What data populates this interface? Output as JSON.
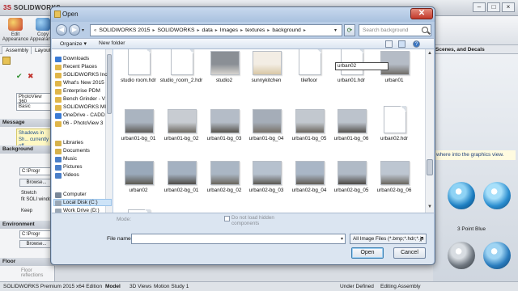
{
  "app": {
    "title_logo_brand": "SOLIDWORKS",
    "ribbon": [
      "Edit Appearance",
      "Copy Appearance"
    ],
    "tabs": [
      "Assembly",
      "Layout"
    ],
    "right_panel_title": "Scenes, and Decals",
    "hint_text": "where into the graphics view.",
    "appearance_items": [
      "3 Point Blue"
    ],
    "left_panel": {
      "edition_label": "PhotoView 360",
      "basic_tab": "Basic",
      "message_title": "Message",
      "message_text": "Shadows in Sh... currently off.",
      "background_title": "Background",
      "path_value": "C:\\Progr",
      "browse_label": "Browse...",
      "stretch_label": "Stretch",
      "fit_label": "fit SOLI windo",
      "keep_label": "Keep",
      "environment_title": "Environment",
      "floor_title": "Floor",
      "floor_reflect": "Floor reflections"
    },
    "status_bar": {
      "edition": "SOLIDWORKS Premium 2015 x64 Edition",
      "tabs": [
        "Model",
        "3D Views",
        "Motion Study 1"
      ],
      "state": "Under Defined",
      "mode": "Editing Assembly"
    }
  },
  "dialog": {
    "title": "Open",
    "close_glyph": "✕",
    "path": [
      "SOLIDWORKS 2015",
      "SOLIDWORKS",
      "data",
      "Images",
      "textures",
      "background"
    ],
    "path_prefix": "«",
    "search_placeholder": "Search background",
    "toolbar": {
      "organize": "Organize ▾",
      "new_folder": "New folder"
    },
    "nav_items": [
      {
        "label": "Downloads",
        "color": "#3a7bd5"
      },
      {
        "label": "Recent Places",
        "color": "#e0b64a"
      },
      {
        "label": "SOLIDWORKS Inc",
        "color": "#e0b64a"
      },
      {
        "label": "What's New 2015",
        "color": "#e0b64a"
      },
      {
        "label": "Enterprise PDM",
        "color": "#e0b64a"
      },
      {
        "label": "Bench Grinder - V",
        "color": "#e0b64a"
      },
      {
        "label": "SOLIDWORKS MI",
        "color": "#e0b64a"
      },
      {
        "label": "OneDrive - CADD",
        "color": "#3a7bd5"
      },
      {
        "label": "06 - PhotoView 3",
        "color": "#e0b64a"
      },
      {
        "label": "Libraries",
        "color": "#d6b24c"
      },
      {
        "label": "Documents",
        "color": "#d6b24c"
      },
      {
        "label": "Music",
        "color": "#4a7fc9"
      },
      {
        "label": "Pictures",
        "color": "#4a7fc9"
      },
      {
        "label": "Videos",
        "color": "#4a7fc9"
      },
      {
        "label": "Computer",
        "color": "#7a8899"
      },
      {
        "label": "Local Disk (C:)",
        "color": "#9aa7b5"
      },
      {
        "label": "Work Drive (D:)",
        "color": "#9aa7b5"
      }
    ],
    "files": [
      {
        "label": "studio room.hdr",
        "kind": "doc",
        "c1": "#ffffff",
        "c2": "#ffffff"
      },
      {
        "label": "studio_room_2.hdr",
        "kind": "doc",
        "c1": "#ffffff",
        "c2": "#ffffff"
      },
      {
        "label": "studio2",
        "kind": "img",
        "c1": "#8a8f95",
        "c2": "#d7d4cf"
      },
      {
        "label": "sunnykitchen",
        "kind": "img",
        "c1": "#f3ede4",
        "c2": "#d9c7a6"
      },
      {
        "label": "tilefloor",
        "kind": "doc",
        "c1": "#ffffff",
        "c2": "#ffffff"
      },
      {
        "label": "urban01.hdr",
        "kind": "doc",
        "c1": "#ffffff",
        "c2": "#ffffff"
      },
      {
        "label": "urban01",
        "kind": "img",
        "c1": "#b5bcc6",
        "c2": "#6f6b66"
      },
      {
        "label": "urban01-bg_01",
        "kind": "img",
        "c1": "#aab4c0",
        "c2": "#5e5b57"
      },
      {
        "label": "urban01-bg_02",
        "kind": "img",
        "c1": "#c8ccd2",
        "c2": "#6e6a62"
      },
      {
        "label": "urban01-bg_03",
        "kind": "img",
        "c1": "#b4bcc7",
        "c2": "#57534c"
      },
      {
        "label": "urban01-bg_04",
        "kind": "img",
        "c1": "#a5adb8",
        "c2": "#777168"
      },
      {
        "label": "urban01-bg_05",
        "kind": "img",
        "c1": "#c2c8cf",
        "c2": "#6b665e"
      },
      {
        "label": "urban01-bg_06",
        "kind": "img",
        "c1": "#bcc3cc",
        "c2": "#55524e"
      },
      {
        "label": "urban02.hdr",
        "kind": "doc",
        "c1": "#ffffff",
        "c2": "#ffffff"
      },
      {
        "label": "urban02",
        "kind": "img",
        "c1": "#9aa9ba",
        "c2": "#5d5a52"
      },
      {
        "label": "urban02-bg_01",
        "kind": "img",
        "c1": "#a4b1c1",
        "c2": "#4f4c47"
      },
      {
        "label": "urban02-bg_02",
        "kind": "img",
        "c1": "#aab6c4",
        "c2": "#6a655c"
      },
      {
        "label": "urban02-bg_03",
        "kind": "img",
        "c1": "#b6c1ce",
        "c2": "#5b5852"
      },
      {
        "label": "urban02-bg_04",
        "kind": "img",
        "c1": "#a9b6c6",
        "c2": "#615c55"
      },
      {
        "label": "urban02-bg_05",
        "kind": "img",
        "c1": "#b0bac6",
        "c2": "#4c4944"
      },
      {
        "label": "urban02-bg_06",
        "kind": "img",
        "c1": "#bdc6d1",
        "c2": "#6a665f"
      },
      {
        "label": "",
        "kind": "doc",
        "c1": "#ffffff",
        "c2": "#ffffff"
      },
      {
        "label": "",
        "kind": "img",
        "c1": "#3f6fb5",
        "c2": "#8eb3df"
      },
      {
        "label": "",
        "kind": "img",
        "c1": "#4a7dc2",
        "c2": "#a5c4e8"
      },
      {
        "label": "",
        "kind": "img",
        "c1": "#3d6cb2",
        "c2": "#9abce2"
      },
      {
        "label": "",
        "kind": "img",
        "c1": "#5887c7",
        "c2": "#b4cfec"
      },
      {
        "label": "",
        "kind": "img",
        "c1": "#4574bb",
        "c2": "#a0c0e5"
      },
      {
        "label": "",
        "kind": "img",
        "c1": "#4d7fc3",
        "c2": "#aac7e9"
      }
    ],
    "rename_value": "urban02",
    "mode_label": "Mode:",
    "checkbox_label": "Do not load hidden components",
    "filename_label": "File name:",
    "filename_value": "",
    "filetype_value": "All Image Files (*.bmp;*.hdr;*.jp",
    "open_label": "Open",
    "cancel_label": "Cancel"
  }
}
